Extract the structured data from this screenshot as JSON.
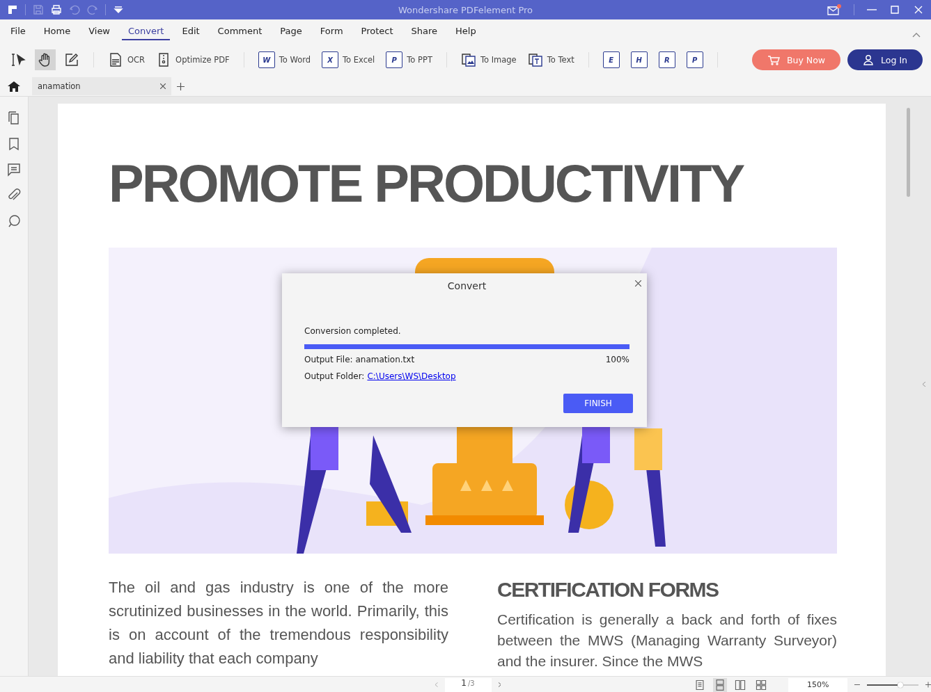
{
  "window": {
    "title": "Wondershare PDFelement Pro"
  },
  "menu": [
    {
      "label": "File",
      "selected": false
    },
    {
      "label": "Home",
      "selected": false
    },
    {
      "label": "View",
      "selected": false
    },
    {
      "label": "Convert",
      "selected": true
    },
    {
      "label": "Edit",
      "selected": false
    },
    {
      "label": "Comment",
      "selected": false
    },
    {
      "label": "Page",
      "selected": false
    },
    {
      "label": "Form",
      "selected": false
    },
    {
      "label": "Protect",
      "selected": false
    },
    {
      "label": "Share",
      "selected": false
    },
    {
      "label": "Help",
      "selected": false
    }
  ],
  "tools": [
    {
      "kind": "select",
      "selected": false
    },
    {
      "kind": "hand",
      "selected": true
    },
    {
      "kind": "edit",
      "selected": false
    }
  ],
  "toolbar_groups": [
    [
      {
        "kind": "ocr",
        "label": "OCR"
      },
      {
        "kind": "optimize",
        "label": "Optimize PDF"
      }
    ],
    [
      {
        "kind": "doc",
        "letter": "W",
        "label": "To Word"
      },
      {
        "kind": "doc",
        "letter": "X",
        "label": "To Excel"
      },
      {
        "kind": "doc",
        "letter": "P",
        "label": "To PPT"
      }
    ],
    [
      {
        "kind": "image",
        "label": "To Image"
      },
      {
        "kind": "text",
        "label": "To Text"
      }
    ],
    [
      {
        "kind": "doc",
        "letter": "E"
      },
      {
        "kind": "doc",
        "letter": "H"
      },
      {
        "kind": "doc",
        "letter": "R"
      },
      {
        "kind": "doc",
        "letter": "P"
      }
    ]
  ],
  "buy_button": "Buy Now",
  "login_button": "Log In",
  "tab": {
    "label": "anamation"
  },
  "document": {
    "heading": "PROMOTE PRODUCTIVITY",
    "left_paragraph": "The oil and gas industry is one of the more scrutinized businesses in the world. Primarily, this is on account of the tremendous responsibility and liability that each company",
    "right_heading": "CERTIFICATION FORMS",
    "right_paragraph": "Certification is generally a back and forth of fixes between the MWS (Managing Warranty Surveyor) and the insurer. Since the MWS"
  },
  "dialog": {
    "title": "Convert",
    "message": "Conversion completed.",
    "level": 1.0,
    "output_file_label": "Output File:",
    "output_file": "anamation.txt",
    "percent": "100%",
    "output_folder_label": "Output Folder:",
    "output_folder": "C:\\Users\\WS\\Desktop",
    "button": "FINISH"
  },
  "status_bar": {
    "page": "1",
    "page_total": "/3",
    "view_modes": [
      {
        "selected": false
      },
      {
        "selected": true
      },
      {
        "selected": false
      },
      {
        "selected": false
      }
    ],
    "zoom": "150%",
    "zoom_slider": {
      "level": 0.65
    }
  }
}
